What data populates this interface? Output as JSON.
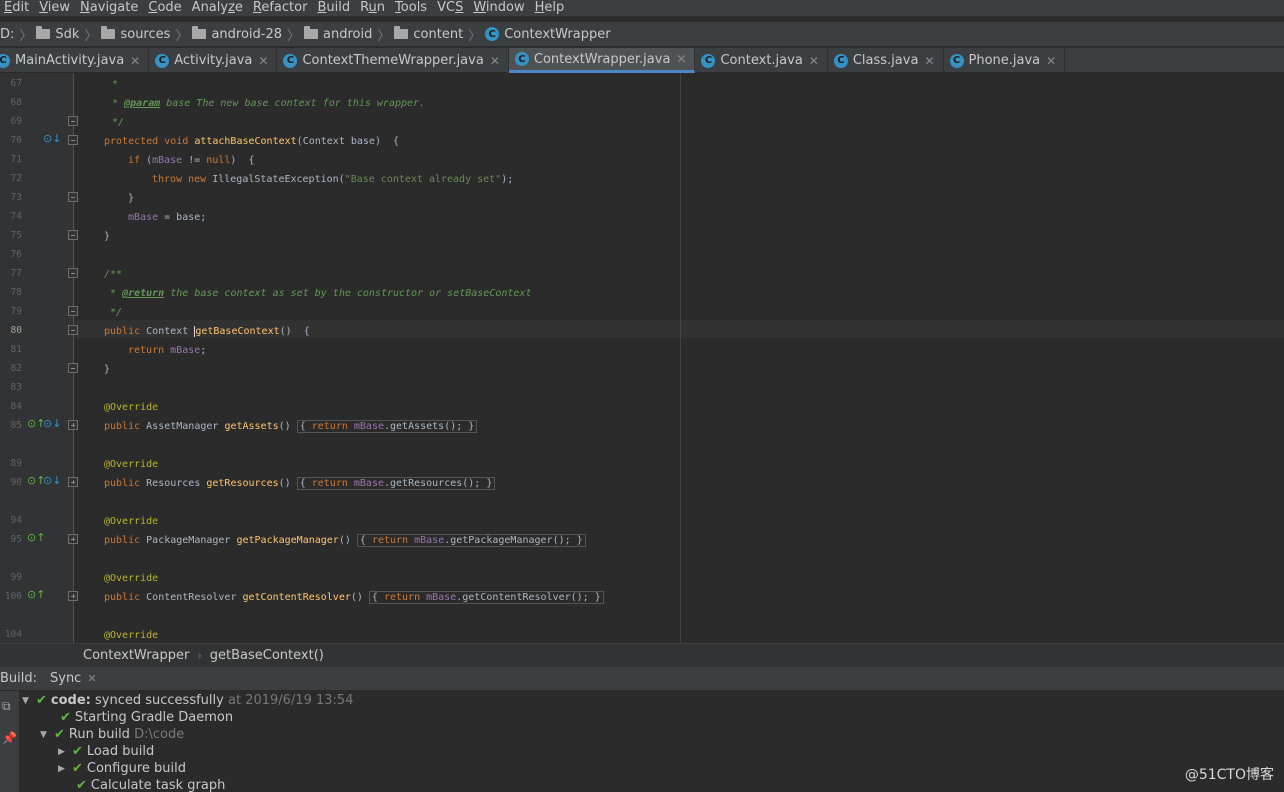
{
  "menu": [
    {
      "pre": "",
      "mn": "E",
      "post": "dit"
    },
    {
      "pre": "",
      "mn": "V",
      "post": "iew"
    },
    {
      "pre": "",
      "mn": "N",
      "post": "avigate"
    },
    {
      "pre": "",
      "mn": "C",
      "post": "ode"
    },
    {
      "pre": "Analy",
      "mn": "z",
      "post": "e"
    },
    {
      "pre": "",
      "mn": "R",
      "post": "efactor"
    },
    {
      "pre": "",
      "mn": "B",
      "post": "uild"
    },
    {
      "pre": "R",
      "mn": "u",
      "post": "n"
    },
    {
      "pre": "",
      "mn": "T",
      "post": "ools"
    },
    {
      "pre": "VC",
      "mn": "S",
      "post": ""
    },
    {
      "pre": "",
      "mn": "W",
      "post": "indow"
    },
    {
      "pre": "",
      "mn": "H",
      "post": "elp"
    }
  ],
  "nav": {
    "root": "D:",
    "segments": [
      "Sdk",
      "sources",
      "android-28",
      "android",
      "content"
    ],
    "current": "ContextWrapper"
  },
  "tabs": [
    {
      "label": "MainActivity.java",
      "active": false
    },
    {
      "label": "Activity.java",
      "active": false
    },
    {
      "label": "ContextThemeWrapper.java",
      "active": false
    },
    {
      "label": "ContextWrapper.java",
      "active": true
    },
    {
      "label": "Context.java",
      "active": false
    },
    {
      "label": "Class.java",
      "active": false
    },
    {
      "label": "Phone.java",
      "active": false
    }
  ],
  "line_numbers": [
    "67",
    "68",
    "69",
    "70",
    "71",
    "72",
    "73",
    "74",
    "75",
    "76",
    "77",
    "78",
    "79",
    "80",
    "81",
    "82",
    "83",
    "84",
    "85",
    "89",
    "90",
    "94",
    "95",
    "99",
    "100",
    "104"
  ],
  "current_line": "80",
  "code": {
    "l67": "*",
    "l68_pre": "* ",
    "l68_tag": "@param",
    "l68_post": " base The new base context for this wrapper.",
    "l69": "*/",
    "l70_k": "protected void ",
    "l70_fn": "attachBaseContext",
    "l70_rest": "(Context base)  {",
    "l71_k": "if ",
    "l71_a": "(",
    "l71_fld": "mBase",
    "l71_b": " != ",
    "l71_null": "null",
    "l71_c": ")  {",
    "l72_k": "throw new ",
    "l72_a": "IllegalStateException(",
    "l72_str": "\"Base context already set\"",
    "l72_b": ");",
    "l73": "}",
    "l74_fld": "mBase",
    "l74_rest": " = base;",
    "l75": "}",
    "l77": "/**",
    "l78_pre": " * ",
    "l78_tag": "@return",
    "l78_post": " the base context as set by the constructor or setBaseContext",
    "l79": " */",
    "l80_k": "public ",
    "l80_a": "Context ",
    "l80_fn": "getBaseContext",
    "l80_b": "()  {",
    "l81_k": "return ",
    "l81_fld": "mBase",
    "l81_b": ";",
    "l82": "}",
    "override": "@Override",
    "l85_k": "public ",
    "l85_a": "AssetManager ",
    "l85_fn": "getAssets",
    "l85_b": "() ",
    "l85_body_pre": "{ ",
    "l85_ret": "return ",
    "l85_fld": "mBase",
    "l85_call": ".getAssets();",
    "l85_end": " }",
    "l90_k": "public ",
    "l90_a": "Resources ",
    "l90_fn": "getResources",
    "l90_b": "() ",
    "l90_call": ".getResources();",
    "l95_k": "public ",
    "l95_a": "PackageManager ",
    "l95_fn": "getPackageManager",
    "l95_b": "() ",
    "l95_call": ".getPackageManager();",
    "l100_k": "public ",
    "l100_a": "ContentResolver ",
    "l100_fn": "getContentResolver",
    "l100_b": "() ",
    "l100_call": ".getContentResolver();"
  },
  "editor_breadcrumb": {
    "class": "ContextWrapper",
    "method": "getBaseContext()"
  },
  "build": {
    "title": "Build:",
    "tab": "Sync",
    "root_label": "code:",
    "root_status": "synced successfully",
    "root_time": "at 2019/6/19 13:54",
    "items": [
      {
        "label": "Starting Gradle Daemon",
        "detail": ""
      },
      {
        "label": "Run build",
        "detail": "D:\\code"
      },
      {
        "label": "Load build",
        "detail": ""
      },
      {
        "label": "Configure build",
        "detail": ""
      },
      {
        "label": "Calculate task graph",
        "detail": ""
      }
    ]
  },
  "watermark": "@51CTO博客",
  "colors": {
    "keyword": "#cc7832",
    "comment": "#629755",
    "field": "#9876aa",
    "method": "#ffc66d",
    "string": "#6a8759",
    "annotation": "#bbb529",
    "success": "#62b543",
    "accent": "#4a88c7"
  }
}
